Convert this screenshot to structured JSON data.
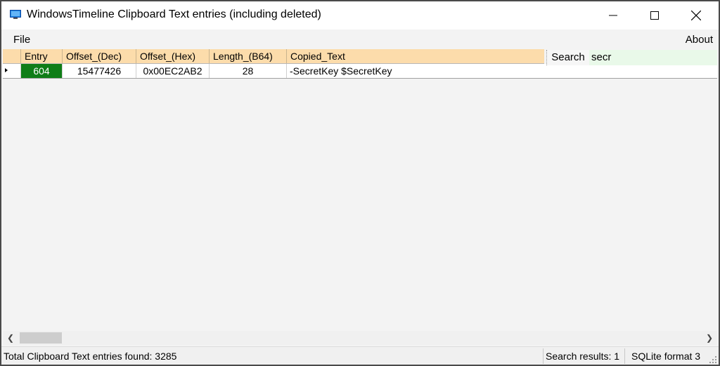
{
  "window": {
    "title": "WindowsTimeline Clipboard Text entries (including deleted)",
    "icon": "app-monitor-icon"
  },
  "menu": {
    "file": "File",
    "about": "About"
  },
  "grid": {
    "columns": [
      "Entry",
      "Offset_(Dec)",
      "Offset_(Hex)",
      "Length_(B64)",
      "Copied_Text"
    ],
    "rows": [
      {
        "entry": "604",
        "offset_dec": "15477426",
        "offset_hex": "0x00EC2AB2",
        "length_b64": "28",
        "copied_text": "-SecretKey $SecretKey"
      }
    ]
  },
  "search": {
    "button_label": "Search",
    "value": "secr"
  },
  "status": {
    "total": "Total Clipboard Text entries found: 3285",
    "results": "Search results: 1",
    "format": "SQLite format 3"
  },
  "colors": {
    "header_bg": "#fcdcab",
    "selected_cell_bg": "#0f7d17",
    "search_bg": "#e9f9e9"
  }
}
